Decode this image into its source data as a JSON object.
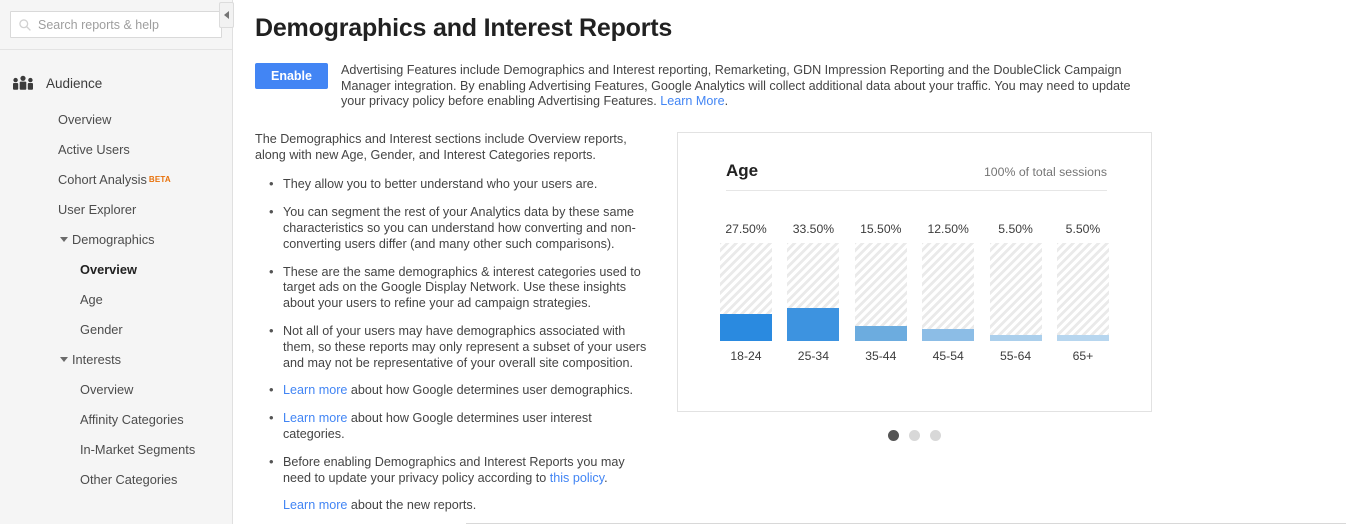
{
  "sidebar": {
    "search": {
      "placeholder": "Search reports & help",
      "value": "",
      "icon": "search-icon"
    },
    "collapse": {
      "icon": "collapse-left-icon"
    },
    "section": {
      "label": "Audience",
      "icon": "audience-people-icon"
    },
    "items": [
      {
        "label": "Overview",
        "level": "item",
        "active": false
      },
      {
        "label": "Active Users",
        "level": "item",
        "active": false
      },
      {
        "label": "Cohort Analysis",
        "level": "item",
        "active": false,
        "badge": "BETA"
      },
      {
        "label": "User Explorer",
        "level": "item",
        "active": false
      },
      {
        "label": "Demographics",
        "level": "group",
        "active": false,
        "expanded": true
      },
      {
        "label": "Overview",
        "level": "sub",
        "active": true
      },
      {
        "label": "Age",
        "level": "sub",
        "active": false
      },
      {
        "label": "Gender",
        "level": "sub",
        "active": false
      },
      {
        "label": "Interests",
        "level": "group",
        "active": false,
        "expanded": true
      },
      {
        "label": "Overview",
        "level": "sub",
        "active": false
      },
      {
        "label": "Affinity Categories",
        "level": "sub",
        "active": false
      },
      {
        "label": "In-Market Segments",
        "level": "sub",
        "active": false
      },
      {
        "label": "Other Categories",
        "level": "sub",
        "active": false
      }
    ]
  },
  "main": {
    "title": "Demographics and Interest Reports",
    "banner": {
      "button_label": "Enable",
      "text": "Advertising Features include Demographics and Interest reporting, Remarketing, GDN Impression Reporting and the DoubleClick Campaign Manager integration. By enabling Advertising Features, Google Analytics will collect additional data about your traffic. You may need to update your privacy policy before enabling Advertising Features. ",
      "link_label": "Learn More",
      "text_tail": "."
    },
    "intro": "The Demographics and Interest sections include Overview reports, along with new Age, Gender, and Interest Categories reports.",
    "bullets": [
      {
        "pre": "They allow you to better understand who your users are.",
        "link": "",
        "post": ""
      },
      {
        "pre": "You can segment the rest of your Analytics data by these same characteristics so you can understand how converting and non-converting users differ (and many other such comparisons).",
        "link": "",
        "post": ""
      },
      {
        "pre": "These are the same demographics & interest categories used to target ads on the Google Display Network. Use these insights about your users to refine your ad campaign strategies.",
        "link": "",
        "post": ""
      },
      {
        "pre": "Not all of your users may have demographics associated with them, so these reports may only represent a subset of your users and may not be representative of your overall site composition.",
        "link": "",
        "post": ""
      },
      {
        "pre": "",
        "link": "Learn more",
        "post": " about how Google determines user demographics."
      },
      {
        "pre": "",
        "link": "Learn more",
        "post": " about how Google determines user interest categories."
      },
      {
        "pre": "Before enabling Demographics and Interest Reports you may need to update your privacy policy according to ",
        "link": "this policy",
        "post": "."
      },
      {
        "pre": "",
        "link": "Learn more",
        "post": " about the new reports.",
        "nobullet": true
      }
    ],
    "pagination": {
      "count": 3,
      "active_index": 0
    }
  },
  "chart_data": {
    "type": "bar",
    "title": "Age",
    "subtitle": "100% of total sessions",
    "categories": [
      "18-24",
      "25-34",
      "35-44",
      "45-54",
      "55-64",
      "65+"
    ],
    "values": [
      27.5,
      33.5,
      15.5,
      12.5,
      5.5,
      5.5
    ],
    "value_labels": [
      "27.50%",
      "33.50%",
      "15.50%",
      "12.50%",
      "5.50%",
      "5.50%"
    ],
    "bar_colors": [
      "#2a8ae0",
      "#3d93e0",
      "#6cacdf",
      "#8cbde6",
      "#abcfec",
      "#b7d6ef"
    ],
    "xlabel": "",
    "ylabel": "",
    "ylim": [
      0,
      100
    ],
    "grid": false,
    "legend": "none",
    "track_style": "diagonal-hatch"
  }
}
